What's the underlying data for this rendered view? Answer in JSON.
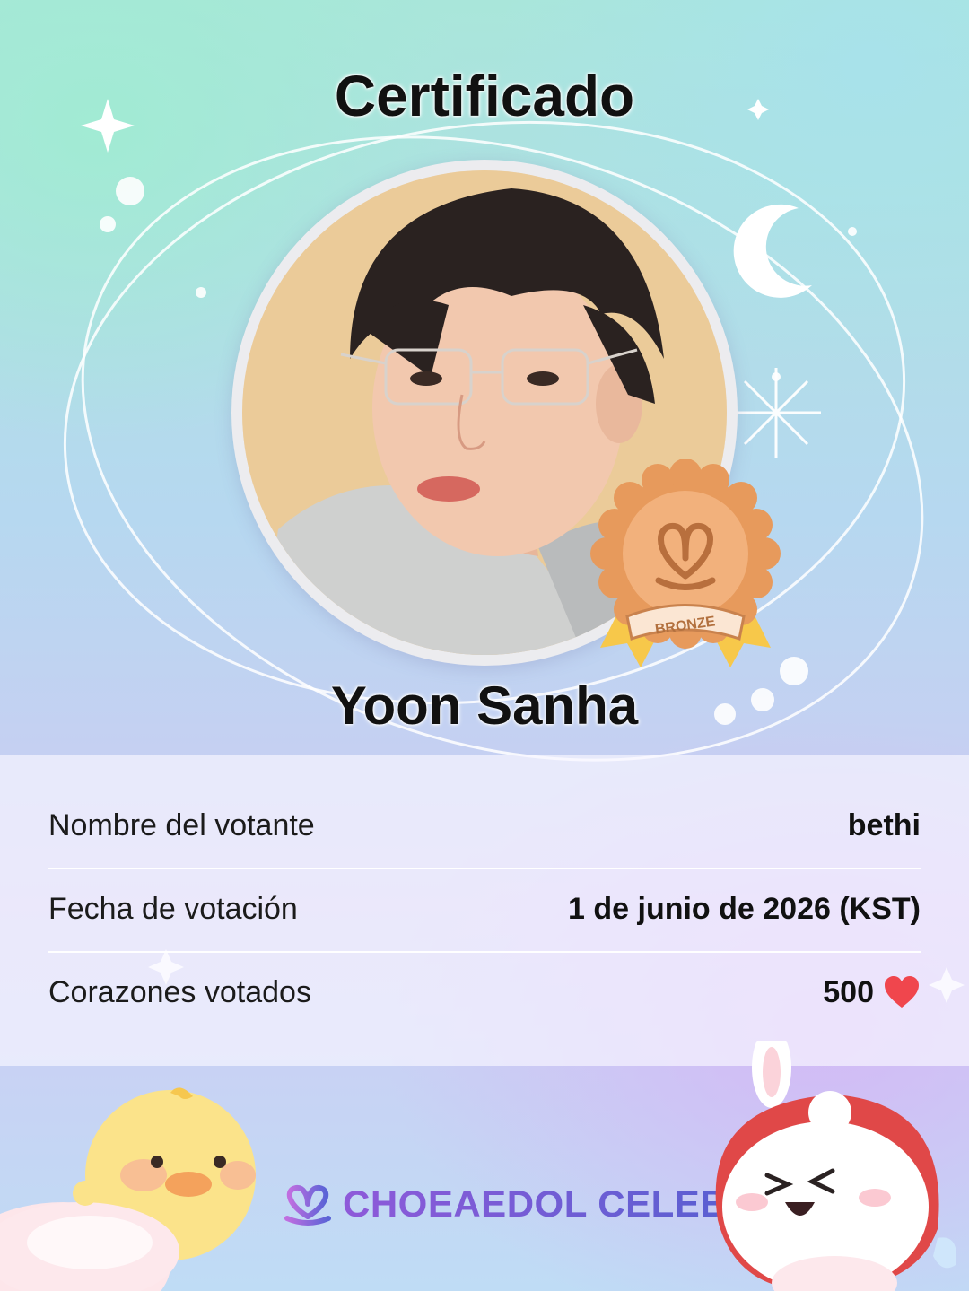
{
  "certificate": {
    "title": "Certificado",
    "idol_name": "Yoon Sanha",
    "badge_text": "BRONZE",
    "badge_tier": "bronze"
  },
  "info": {
    "rows": [
      {
        "label": "Nombre del votante",
        "value": "bethi"
      },
      {
        "label": "Fecha de votación",
        "value": "1 de junio de 2026 (KST)"
      },
      {
        "label": "Corazones votados",
        "value": "500"
      }
    ],
    "heart_icon": "heart-icon",
    "heart_color": "#f0464d"
  },
  "brand": {
    "name": "CHOEAEDOL CELEB",
    "logo_icon": "heart-loop-logo-icon",
    "color": "#7a4fd0"
  },
  "colors": {
    "badge": "#e79a5c",
    "ribbon": "#f7c84a",
    "text": "#111111"
  }
}
